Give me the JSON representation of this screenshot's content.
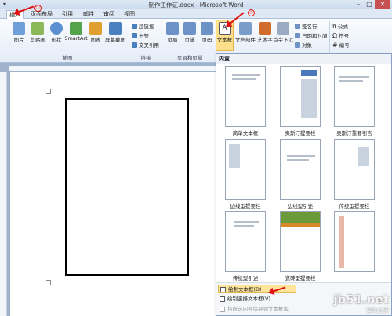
{
  "window": {
    "title": "制作工作证.docx - Microsoft Word",
    "qat": "▾",
    "buttons": {
      "min": "–",
      "max": "□",
      "close": "✕"
    }
  },
  "tabs": [
    "插入",
    "页面布局",
    "引用",
    "邮件",
    "审阅",
    "视图"
  ],
  "ribbon": {
    "buttons": {
      "picture": "图片",
      "clipart": "剪贴画",
      "shapes": "形状",
      "smartart": "SmartArt",
      "chart": "图表",
      "screenshot": "屏幕截图",
      "header": "页眉",
      "footer": "页脚",
      "pagenum": "页码",
      "textbox": "文本框",
      "docparts": "文档部件",
      "wordart": "艺术字",
      "dropcap": "首字下沉",
      "equation": "公式",
      "symbol": "符号",
      "numbering": "编号"
    },
    "links": {
      "hyperlink": "超链接",
      "bookmark": "书签",
      "crossref": "交叉引用"
    },
    "text_small": {
      "sigline": "签名行",
      "datetime": "日期和时间",
      "object": "对象"
    },
    "groups": {
      "illustrations": "插图",
      "links": "链接",
      "header_footer": "页眉和页脚"
    }
  },
  "gallery": {
    "header": "内置",
    "items": [
      "简单文本框",
      "奥斯汀提要栏",
      "奥斯汀重要引言",
      "边线型提要栏",
      "边线型引述",
      "传统型提要栏",
      "传统型引述",
      "瓷砖型提要栏"
    ],
    "menu": {
      "draw": "绘制文本框(D)",
      "draw_vertical": "绘制竖排文本框(V)",
      "save": "将所选内容保存到文本框库"
    }
  },
  "annotations": {
    "one": "①",
    "two": "②"
  },
  "watermark": {
    "line1": "jb51.net",
    "line2": "脚本之家"
  }
}
